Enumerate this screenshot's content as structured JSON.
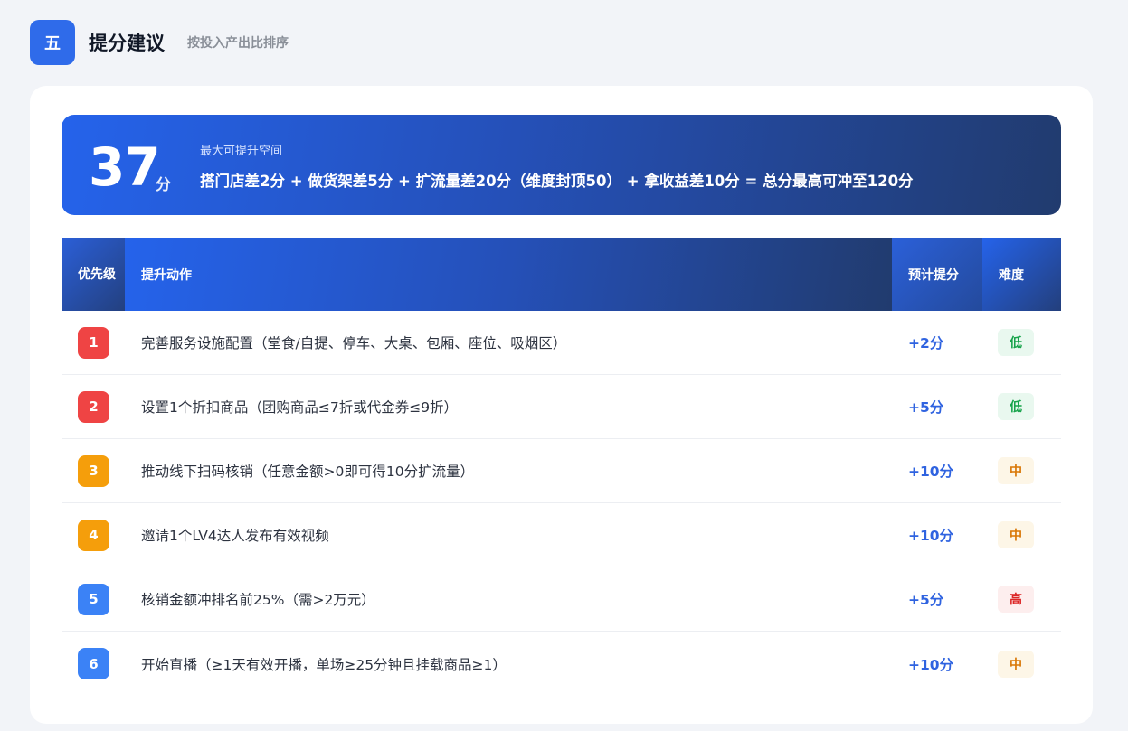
{
  "header": {
    "badge": "五",
    "title": "提分建议",
    "subtitle": "按投入产出比排序"
  },
  "banner": {
    "number": "37",
    "unit": "分",
    "label": "最大可提升空间",
    "formula": "搭门店差2分 + 做货架差5分 + 扩流量差20分（维度封顶50） + 拿收益差10分 = 总分最高可冲至120分"
  },
  "table": {
    "headers": {
      "priority": "优先级",
      "action": "提升动作",
      "points": "预计提分",
      "difficulty": "难度"
    },
    "rows": [
      {
        "priority": "1",
        "action": "完善服务设施配置（堂食/自提、停车、大桌、包厢、座位、吸烟区）",
        "points": "+2分",
        "difficulty": "低",
        "badge_color": "#ef4444",
        "diff_bg": "#e9f8ef",
        "diff_color": "#16a34a"
      },
      {
        "priority": "2",
        "action": "设置1个折扣商品（团购商品≤7折或代金券≤9折）",
        "points": "+5分",
        "difficulty": "低",
        "badge_color": "#ef4444",
        "diff_bg": "#e9f8ef",
        "diff_color": "#16a34a"
      },
      {
        "priority": "3",
        "action": "推动线下扫码核销（任意金额>0即可得10分扩流量）",
        "points": "+10分",
        "difficulty": "中",
        "badge_color": "#f59e0b",
        "diff_bg": "#fdf6e7",
        "diff_color": "#d97706"
      },
      {
        "priority": "4",
        "action": "邀请1个LV4达人发布有效视频",
        "points": "+10分",
        "difficulty": "中",
        "badge_color": "#f59e0b",
        "diff_bg": "#fdf6e7",
        "diff_color": "#d97706"
      },
      {
        "priority": "5",
        "action": "核销金额冲排名前25%（需>2万元）",
        "points": "+5分",
        "difficulty": "高",
        "badge_color": "#3b82f6",
        "diff_bg": "#fdeeee",
        "diff_color": "#dc2626"
      },
      {
        "priority": "6",
        "action": "开始直播（≥1天有效开播，单场≥25分钟且挂载商品≥1）",
        "points": "+10分",
        "difficulty": "中",
        "badge_color": "#3b82f6",
        "diff_bg": "#fdf6e7",
        "diff_color": "#d97706"
      }
    ]
  }
}
